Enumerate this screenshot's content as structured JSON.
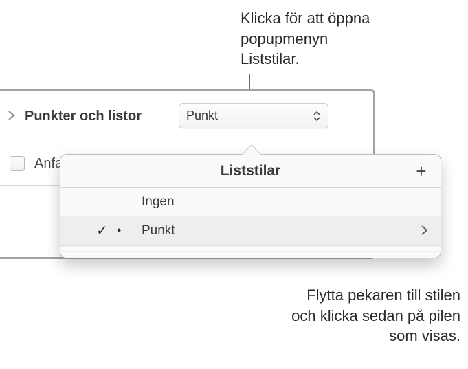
{
  "callouts": {
    "top": "Klicka för att öppna\npopupmenyn\nListstilar.",
    "bottom": "Flytta pekaren till stilen\noch klicka sedan på pilen\nsom visas."
  },
  "panel": {
    "section_label": "Punkter och listor",
    "popup_value": "Punkt",
    "checkbox_label": "Anfa"
  },
  "popover": {
    "title": "Liststilar",
    "add_symbol": "+",
    "rows": [
      {
        "label": "Ingen",
        "selected": false
      },
      {
        "label": "Punkt",
        "selected": true
      }
    ]
  }
}
